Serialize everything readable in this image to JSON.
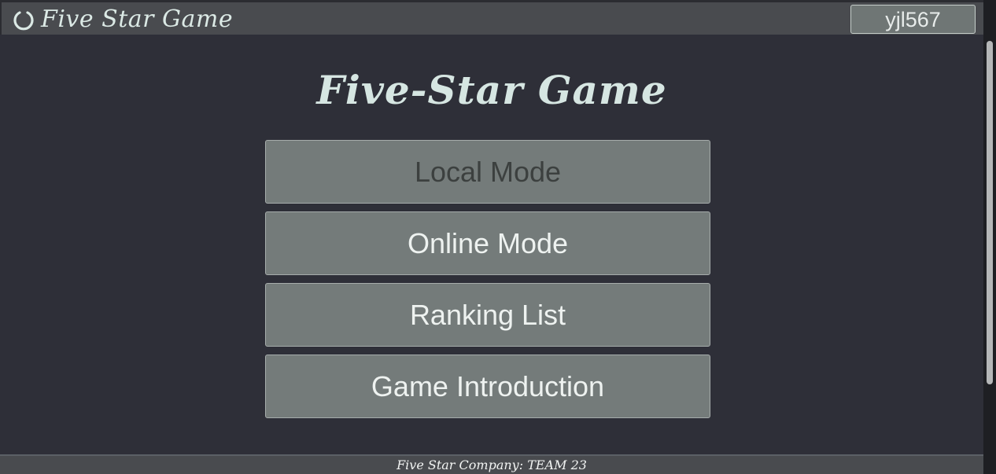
{
  "header": {
    "brand_title": "Five Star Game",
    "brand_icon": "refresh-ring-icon",
    "user_label": "yjl567"
  },
  "main": {
    "title": "Five-Star Game",
    "menu": [
      {
        "label": "Local Mode",
        "state": "disabled"
      },
      {
        "label": "Online Mode",
        "state": "enabled"
      },
      {
        "label": "Ranking List",
        "state": "enabled"
      },
      {
        "label": "Game Introduction",
        "state": "enabled"
      }
    ]
  },
  "footer": {
    "text": "Five Star Company: TEAM 23"
  },
  "colors": {
    "background": "#2e2f38",
    "bar": "#494b4f",
    "button": "#747b7a",
    "title_text": "#d6e6e2"
  }
}
